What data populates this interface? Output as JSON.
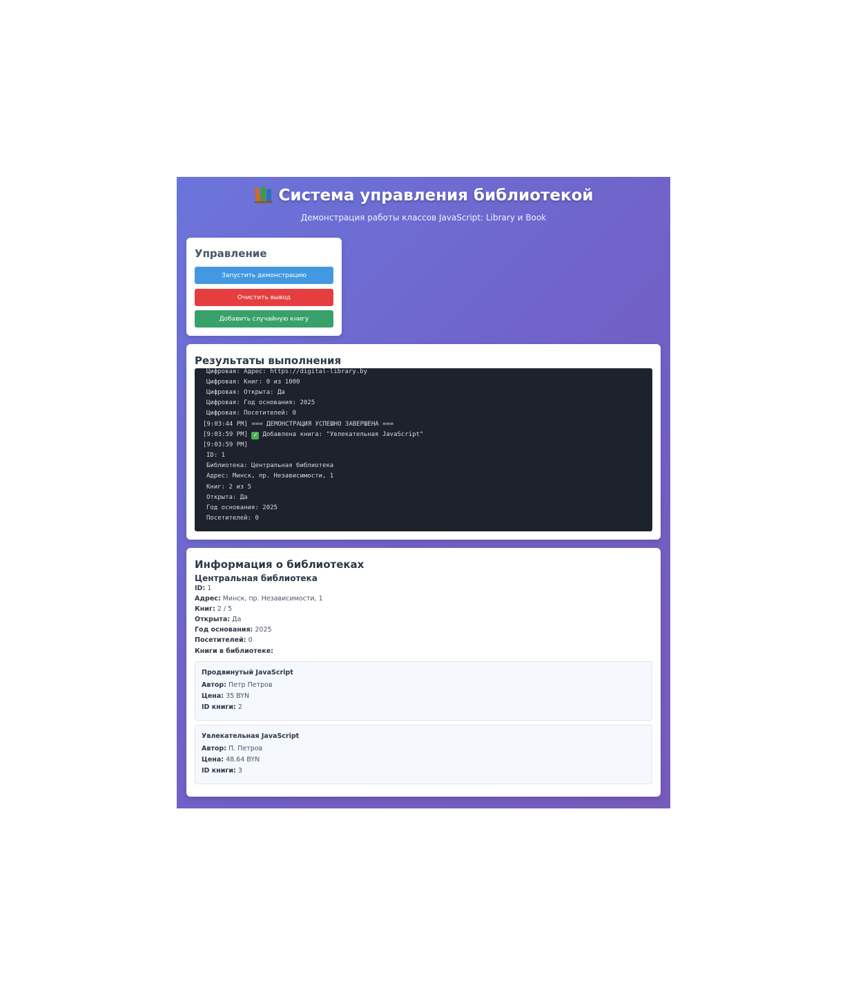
{
  "header": {
    "title": "Система управления библиотекой",
    "title_icon": "books-icon",
    "subtitle": "Демонстрация работы классов JavaScript: Library и Book"
  },
  "controls": {
    "heading": "Управление",
    "run_label": "Запустить демонстрацию",
    "clear_label": "Очистить вывод",
    "add_label": "Добавить случайную книгу",
    "colors": {
      "run": "#4299e1",
      "clear": "#e53e3e",
      "add": "#38a169"
    }
  },
  "results": {
    "heading": "Результаты выполнения",
    "log": [
      "Цифровая: Адрес: https://digital-library.by",
      "Цифровая: Книг: 0 из 1000",
      "Цифровая: Открыта: Да",
      "Цифровая: Год основания: 2025",
      "Цифровая: Посетителей: 0",
      "[9:03:44 PM] === ДЕМОНСТРАЦИЯ УСПЕШНО ЗАВЕРШЕНА ===",
      "[9:03:59 PM]",
      "Добавлена книга: \"Увлекательная JavaScript\"",
      "[9:03:59 PM]",
      "ID: 1",
      "Библиотека: Центральная библиотека",
      "Адрес: Минск, пр. Независимости, 1",
      "Книг: 2 из 5",
      "Открыта: Да",
      "Год основания: 2025",
      "Посетителей: 0"
    ]
  },
  "info": {
    "heading": "Информация о библиотеках",
    "library": {
      "name": "Центральная библиотека",
      "props": [
        {
          "k": "ID:",
          "v": "1"
        },
        {
          "k": "Адрес:",
          "v": "Минск, пр. Независимости, 1"
        },
        {
          "k": "Книг:",
          "v": "2 / 5"
        },
        {
          "k": "Открыта:",
          "v": "Да"
        },
        {
          "k": "Год основания:",
          "v": "2025"
        },
        {
          "k": "Посетителей:",
          "v": "0"
        }
      ],
      "books_label": "Книги в библиотеке:",
      "books": [
        {
          "title": "Продвинутый JavaScript",
          "author_k": "Автор:",
          "author": "Петр Петров",
          "price_k": "Цена:",
          "price": "35 BYN",
          "id_k": "ID книги:",
          "id": "2"
        },
        {
          "title": "Увлекательная JavaScript",
          "author_k": "Автор:",
          "author": "П. Петров",
          "price_k": "Цена:",
          "price": "48.64 BYN",
          "id_k": "ID книги:",
          "id": "3"
        }
      ]
    }
  }
}
